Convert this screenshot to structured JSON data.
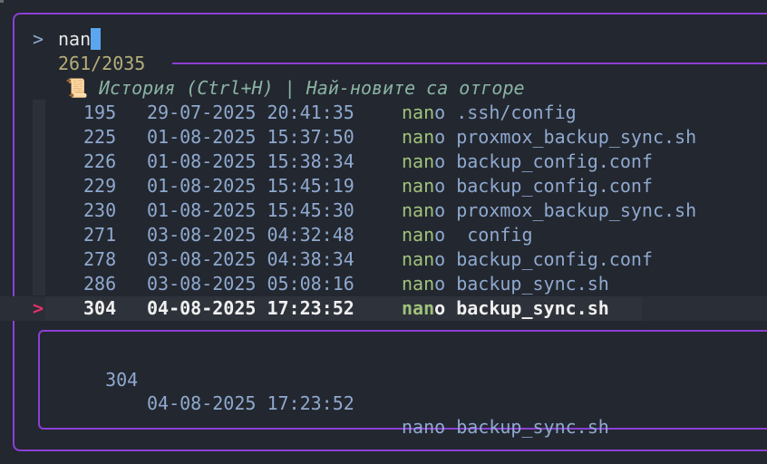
{
  "prompt": {
    "symbol": ">",
    "query": "nan"
  },
  "counter": "261/2035",
  "header": {
    "icon": "📜",
    "text": "История (Ctrl+H) | Най-новите са отгоре"
  },
  "match_highlight": "nan",
  "rows": [
    {
      "num": "195",
      "date": "29-07-2025 20:41:35",
      "cmd_match": "nan",
      "cmd_rest": "o .ssh/config"
    },
    {
      "num": "225",
      "date": "01-08-2025 15:37:50",
      "cmd_match": "nan",
      "cmd_rest": "o proxmox_backup_sync.sh"
    },
    {
      "num": "226",
      "date": "01-08-2025 15:38:34",
      "cmd_match": "nan",
      "cmd_rest": "o backup_config.conf"
    },
    {
      "num": "229",
      "date": "01-08-2025 15:45:19",
      "cmd_match": "nan",
      "cmd_rest": "o backup_config.conf"
    },
    {
      "num": "230",
      "date": "01-08-2025 15:45:30",
      "cmd_match": "nan",
      "cmd_rest": "o proxmox_backup_sync.sh"
    },
    {
      "num": "271",
      "date": "03-08-2025 04:32:48",
      "cmd_match": "nan",
      "cmd_rest": "o  config"
    },
    {
      "num": "278",
      "date": "03-08-2025 04:38:34",
      "cmd_match": "nan",
      "cmd_rest": "o backup_config.conf"
    },
    {
      "num": "286",
      "date": "03-08-2025 05:08:16",
      "cmd_match": "nan",
      "cmd_rest": "o backup_sync.sh"
    }
  ],
  "selected": {
    "marker": ">",
    "num": "304",
    "date": "04-08-2025 17:23:52",
    "cmd_match": "nan",
    "cmd_rest": "o backup_sync.sh"
  },
  "preview": {
    "num": "304",
    "date": "04-08-2025 17:23:52",
    "cmd": "nano backup_sync.sh"
  },
  "colors": {
    "background": "#23272f",
    "border": "#8b3fd6",
    "cursor": "#5aa7f0",
    "match": "#9fc27c",
    "marker": "#e0306a",
    "text": "#8fa9cf"
  }
}
